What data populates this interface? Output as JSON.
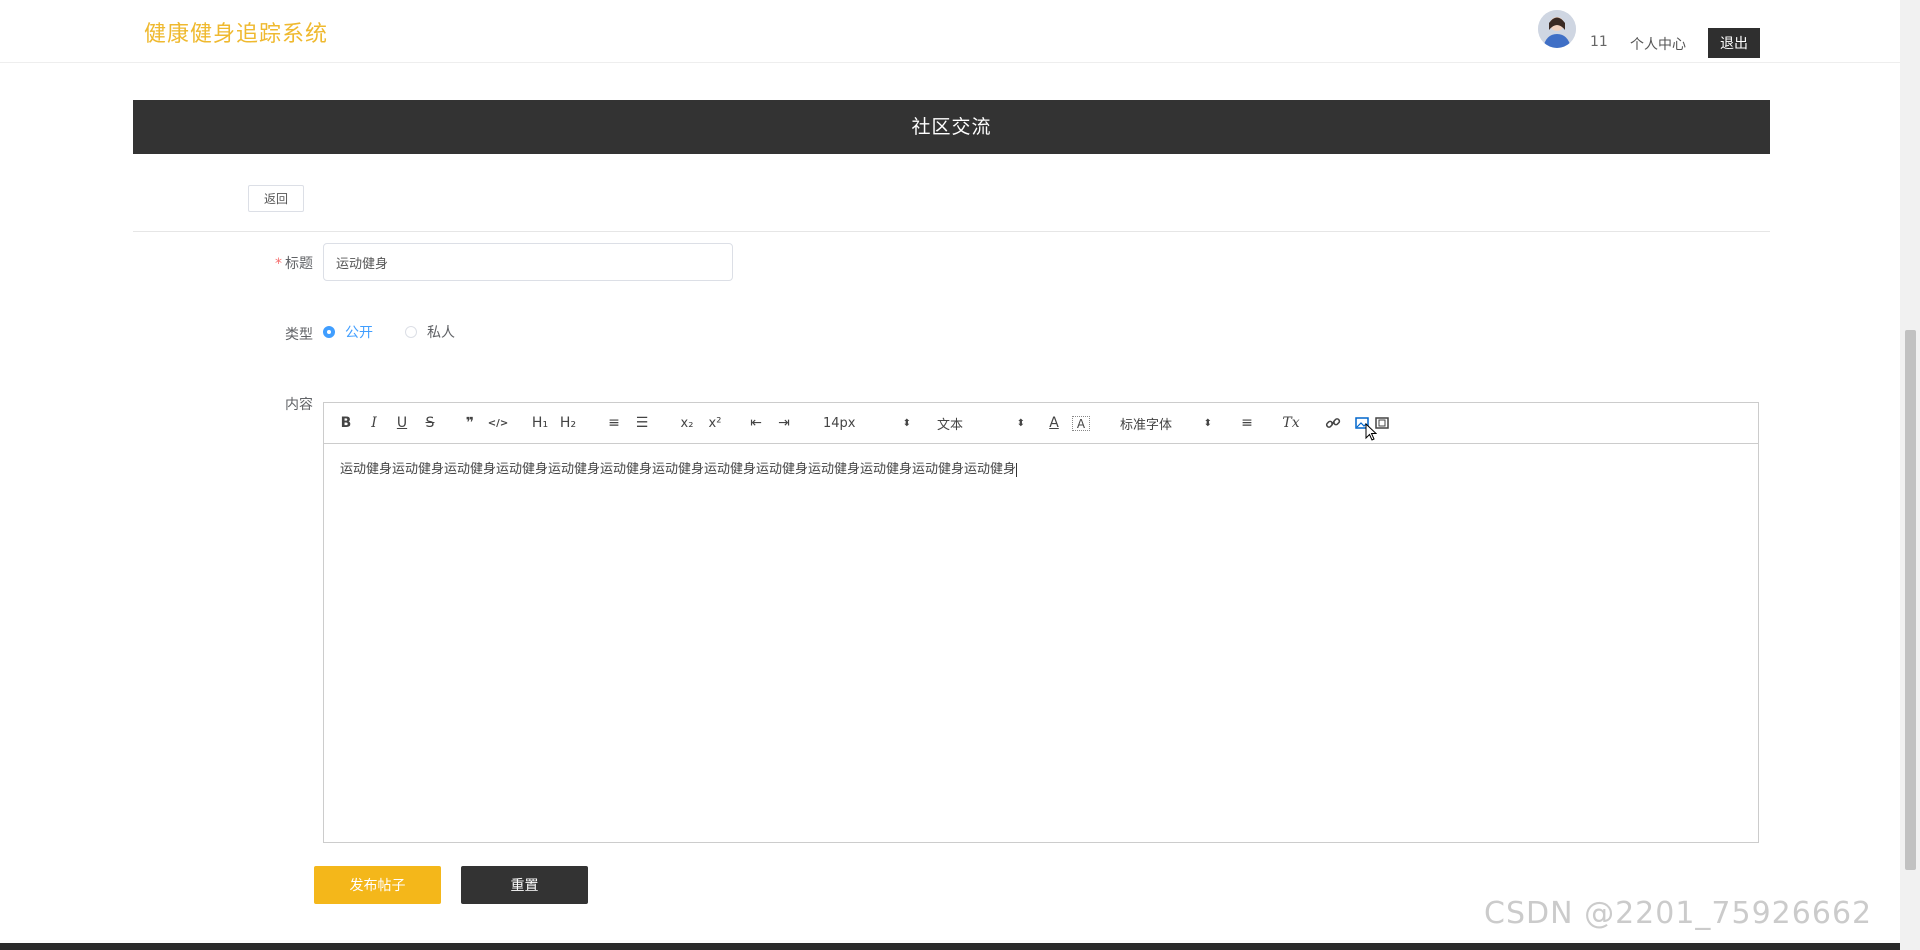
{
  "header": {
    "brand": "健康健身追踪系统",
    "username": "11",
    "profile_label": "个人中心",
    "logout_label": "退出"
  },
  "banner": {
    "title": "社区交流"
  },
  "back_label": "返回",
  "form": {
    "title_label": "标题",
    "title_required": "*",
    "title_value": "运动健身",
    "type_label": "类型",
    "type_options": [
      {
        "label": "公开",
        "selected": true
      },
      {
        "label": "私人",
        "selected": false
      }
    ],
    "content_label": "内容",
    "editor": {
      "toolbar": {
        "bold": "B",
        "italic": "I",
        "underline": "U",
        "strike": "S",
        "blockquote": "❞",
        "code": "</>",
        "h1": "H₁",
        "h2": "H₂",
        "ordered_list": "≡",
        "bullet_list": "☰",
        "subscript": "x₂",
        "superscript": "x²",
        "outdent": "⇤",
        "indent": "⇥",
        "size_value": "14px",
        "header_value": "文本",
        "font_value": "标准字体",
        "align": "≡",
        "clean": "Tx",
        "link": "🔗",
        "image": "▣",
        "video": "▤"
      },
      "content": "运动健身运动健身运动健身运动健身运动健身运动健身运动健身运动健身运动健身运动健身运动健身运动健身运动健身"
    },
    "publish_label": "发布帖子",
    "reset_label": "重置"
  },
  "watermark": "CSDN @2201_75926662",
  "colors": {
    "brand": "#efb92f",
    "banner_bg": "#333333",
    "accent": "#409eff",
    "publish_bg": "#f4b71a",
    "reset_bg": "#333333",
    "required": "#f56c6c"
  }
}
